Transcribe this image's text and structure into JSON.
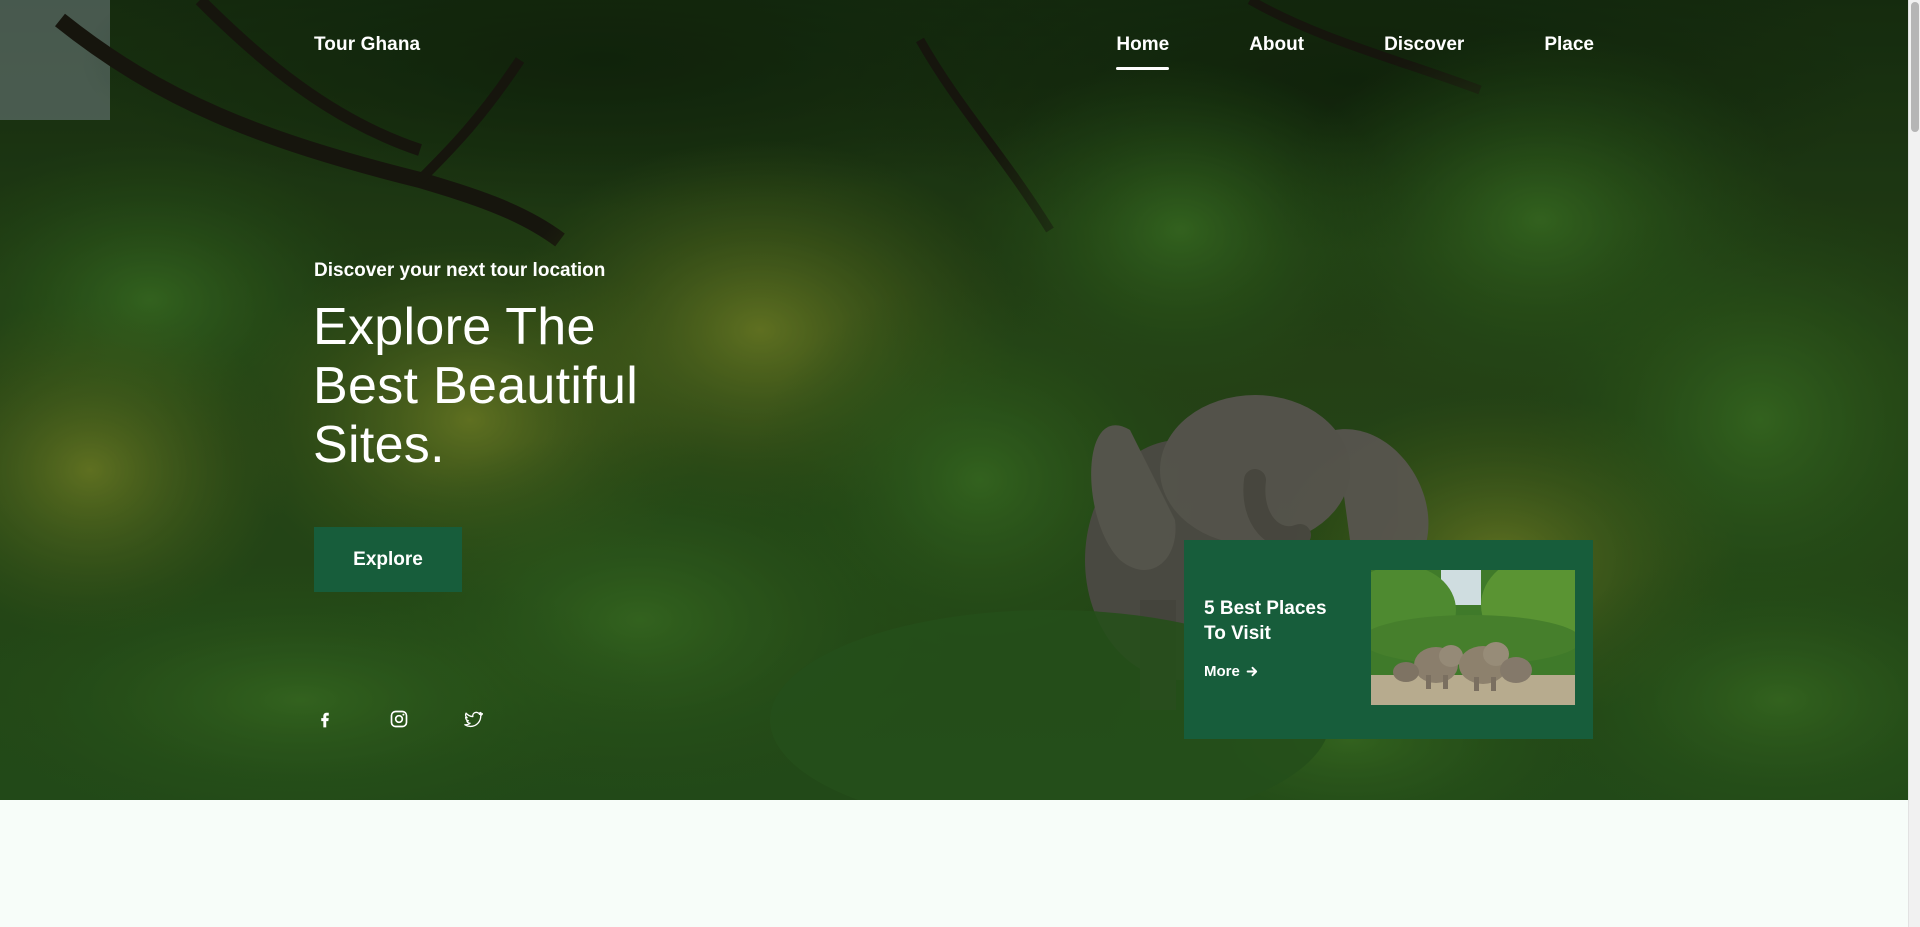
{
  "brand": {
    "name": "Tour Ghana"
  },
  "nav": {
    "items": [
      {
        "label": "Home",
        "active": true
      },
      {
        "label": "About",
        "active": false
      },
      {
        "label": "Discover",
        "active": false
      },
      {
        "label": "Place",
        "active": false
      }
    ]
  },
  "hero": {
    "subtitle": "Discover your next tour location",
    "headline_lines": [
      "Explore The",
      "Best Beautiful",
      "Sites."
    ],
    "cta_label": "Explore",
    "background": "forest-with-elephant-photo"
  },
  "social": [
    {
      "icon": "facebook-icon"
    },
    {
      "icon": "instagram-icon"
    },
    {
      "icon": "twitter-icon"
    }
  ],
  "promo_card": {
    "title_lines": [
      "5 Best Places",
      "To Visit"
    ],
    "link_label": "More",
    "link_icon": "arrow-right-icon",
    "image": "elephant-herd-photo"
  },
  "colors": {
    "accent": "#175d3b",
    "page_background": "#f7fdf9",
    "text_on_dark": "#ffffff"
  }
}
